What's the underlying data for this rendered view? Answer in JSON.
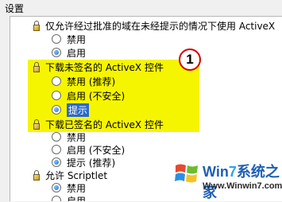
{
  "section_title": "设置",
  "settings": [
    {
      "title": "仅允许经过批准的域在未经提示的情况下使用 ActiveX",
      "options": [
        {
          "label": "禁用",
          "checked": false
        },
        {
          "label": "启用",
          "checked": true
        }
      ]
    },
    {
      "title": "下载未签名的 ActiveX 控件",
      "highlighted": true,
      "options": [
        {
          "label": "禁用 (推荐)",
          "checked": false
        },
        {
          "label": "启用 (不安全)",
          "checked": false
        },
        {
          "label": "提示",
          "checked": true
        }
      ]
    },
    {
      "title": "下载已签名的 ActiveX 控件",
      "options": [
        {
          "label": "禁用",
          "checked": false
        },
        {
          "label": "启用 (不安全)",
          "checked": false
        },
        {
          "label": "提示 (推荐)",
          "checked": true
        }
      ]
    },
    {
      "title": "允许 Scriptlet",
      "options": [
        {
          "label": "禁用",
          "checked": true
        },
        {
          "label": "启用",
          "checked": false
        }
      ]
    }
  ],
  "callout_number": "1",
  "watermark": {
    "brand_prefix": "Win",
    "brand_seven": "7",
    "brand_suffix": "系统之家",
    "url": "Www.Winwin7.com"
  },
  "colors": {
    "highlight": "#f6f500",
    "callout_ring": "#d40000",
    "selection": "#2b6ac8"
  }
}
